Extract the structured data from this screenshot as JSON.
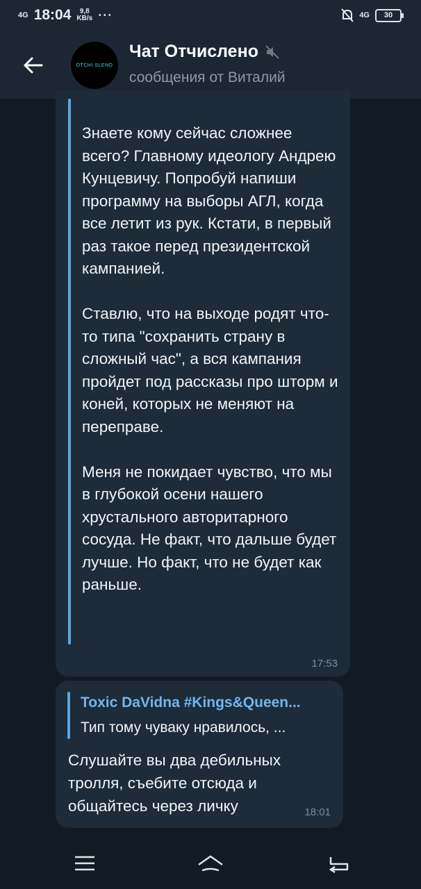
{
  "status_bar": {
    "network_left": "4G",
    "time": "18:04",
    "speed_value": "9,8",
    "speed_unit": "KB/s",
    "dots": "···",
    "network_right": "4G",
    "battery": "30"
  },
  "header": {
    "avatar_text": "OTCHI SLENO",
    "title": "Чат Отчислено",
    "subtitle": "сообщения от Виталий"
  },
  "messages": [
    {
      "text": "Знаете кому сейчас сложнее всего? Главному идеологу Андрею Кунцевичу. Попробуй напиши программу на выборы АГЛ, когда все летит из рук. Кстати, в первый раз такое перед президентской кампанией.\n\nСтавлю, что на выходе родят что-то типа \"сохранить страну в сложный час\", а вся кампания пройдет под рассказы про шторм и коней, которых не меняют на переправе.\n\nМеня не покидает чувство, что мы в глубокой осени нашего хрустального авторитарного сосуда. Не факт, что дальше будет лучше. Но факт, что не будет как раньше.",
      "time": "17:53"
    },
    {
      "reply_name": "Toxic DaVidna #Kings&Queen...",
      "reply_text": "Тип тому чуваку нравилось, ...",
      "text": "Слушайте вы два дебильных тролля, съебите отсюда и общайтесь через личку",
      "time": "18:01"
    }
  ],
  "icons": {
    "back": "arrow-left-icon",
    "mute": "muted-speaker-icon",
    "menu": "menu-icon",
    "home": "home-icon",
    "back_nav": "return-icon"
  },
  "colors": {
    "background": "#121a24",
    "header": "#1c2733",
    "bubble": "#1e2b38",
    "accent": "#5aa7e6",
    "reply_name": "#6fb6f2"
  }
}
